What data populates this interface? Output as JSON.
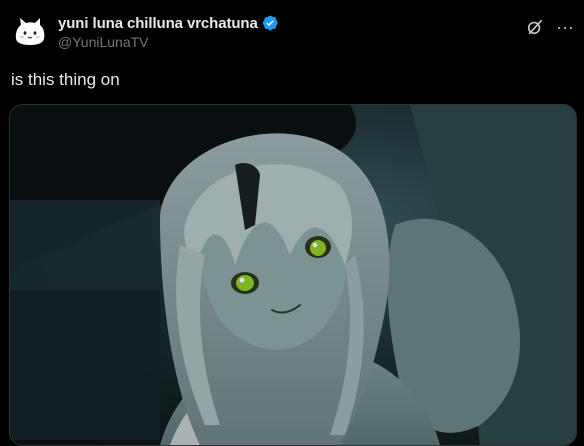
{
  "author": {
    "display_name": "yuni luna chilluna vrchatuna",
    "handle": "@YuniLunaTV",
    "verified": true,
    "avatar_icon": "white-cat-avatar"
  },
  "tweet": {
    "text": "is this thing on"
  },
  "actions": {
    "grok_icon": "grok-icon",
    "more_icon": "more-dots-icon",
    "more_label": "···"
  },
  "media": {
    "description_icon": "vr-avatar-selfie-photo"
  },
  "colors": {
    "background": "#000000",
    "text": "#e7e9ea",
    "secondary": "#71767b",
    "verified": "#1d9bf0"
  }
}
